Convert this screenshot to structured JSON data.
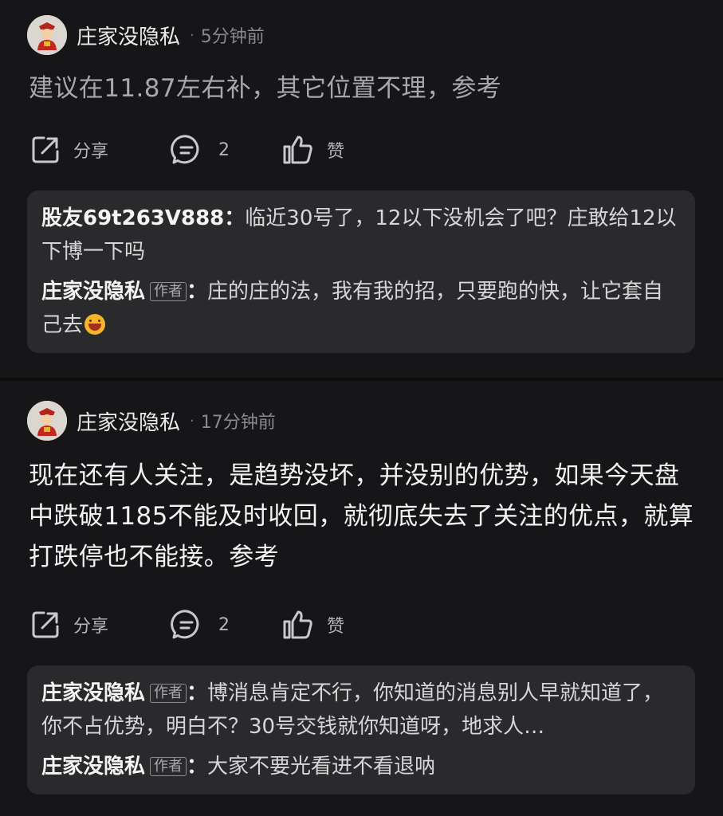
{
  "posts": [
    {
      "author": "庄家没隐私",
      "time": "5分钟前",
      "content": "建议在11.87左右补，其它位置不理，参考",
      "actions": {
        "share": "分享",
        "comment_count": "2",
        "like": "赞"
      },
      "replies": [
        {
          "name": "股友69t263V888",
          "is_author": false,
          "badge": "",
          "sep": "：",
          "text": "临近30号了，12以下没机会了吧？庄敢给12以下博一下吗",
          "emoji": ""
        },
        {
          "name": "庄家没隐私",
          "is_author": true,
          "badge": "作者",
          "sep": "：",
          "text": "庄的庄的法，我有我的招，只要跑的快，让它套自己去",
          "emoji": "grinning-face-emoji"
        }
      ]
    },
    {
      "author": "庄家没隐私",
      "time": "17分钟前",
      "content": "现在还有人关注，是趋势没坏，并没别的优势，如果今天盘中跌破1185不能及时收回，就彻底失去了关注的优点，就算打跌停也不能接。参考",
      "actions": {
        "share": "分享",
        "comment_count": "2",
        "like": "赞"
      },
      "replies": [
        {
          "name": "庄家没隐私",
          "is_author": true,
          "badge": "作者",
          "sep": "：",
          "text": "博消息肯定不行，你知道的消息别人早就知道了，你不占优势，明白不？30号交钱就你知道呀，地求人…",
          "emoji": ""
        },
        {
          "name": "庄家没隐私",
          "is_author": true,
          "badge": "作者",
          "sep": "：",
          "text": "大家不要光看进不看退呐",
          "emoji": ""
        }
      ]
    }
  ],
  "colors": {
    "background": "#161618",
    "card": "#2a2a2c",
    "text": "#e9e9ea",
    "muted": "#8a8a8d"
  }
}
